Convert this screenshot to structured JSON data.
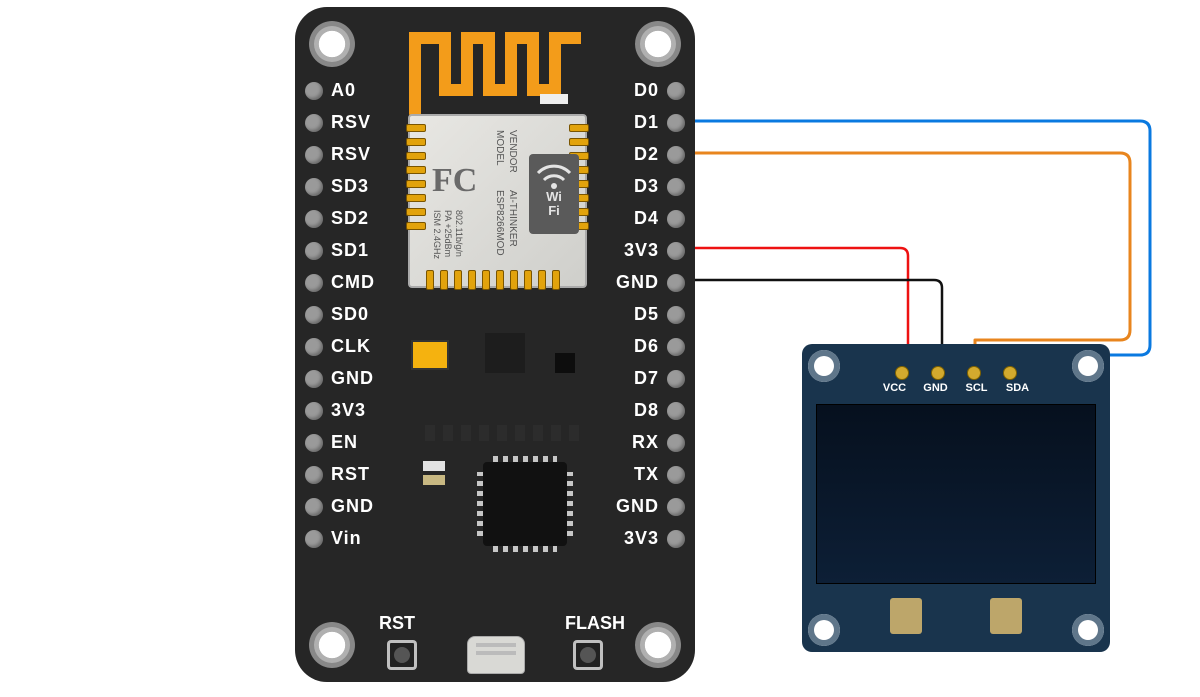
{
  "module": {
    "model_label": "MODEL",
    "vendor_label": "VENDOR",
    "part_no": "ESP8266MOD",
    "vendor": "AI-THINKER",
    "ism": "ISM 2.4GHz",
    "pa": "PA +25dBm",
    "wifi": "802.11b/g/n"
  },
  "buttons": {
    "rst": "RST",
    "flash": "FLASH"
  },
  "pins": {
    "left": [
      "A0",
      "RSV",
      "RSV",
      "SD3",
      "SD2",
      "SD1",
      "CMD",
      "SD0",
      "CLK",
      "GND",
      "3V3",
      "EN",
      "RST",
      "GND",
      "Vin"
    ],
    "right": [
      "D0",
      "D1",
      "D2",
      "D3",
      "D4",
      "3V3",
      "GND",
      "D5",
      "D6",
      "D7",
      "D8",
      "RX",
      "TX",
      "GND",
      "3V3"
    ]
  },
  "oled": {
    "pins": [
      "VCC",
      "GND",
      "SCL",
      "SDA"
    ]
  },
  "wiring": [
    {
      "mcu_pin": "D1",
      "oled_pin": "SDA",
      "color": "#0a79e0"
    },
    {
      "mcu_pin": "D2",
      "oled_pin": "SCL",
      "color": "#e8851e"
    },
    {
      "mcu_pin": "3V3",
      "oled_pin": "VCC",
      "color": "#e11"
    },
    {
      "mcu_pin": "GND",
      "oled_pin": "GND",
      "color": "#111"
    }
  ]
}
